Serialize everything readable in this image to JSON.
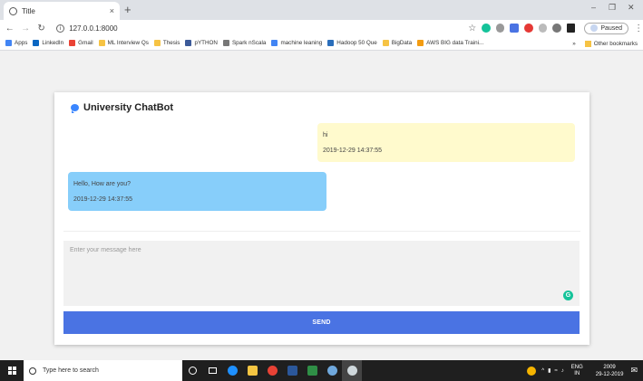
{
  "browser": {
    "tab_title": "Title",
    "tab_close": "×",
    "new_tab": "+",
    "url": "127.0.0.1:8000",
    "profile_status": "Paused",
    "bookmarks": [
      {
        "label": "Apps",
        "color": "#4285f4"
      },
      {
        "label": "LinkedIn",
        "color": "#0a66c2"
      },
      {
        "label": "Gmail",
        "color": "#ea4335"
      },
      {
        "label": "ML Interview Qs",
        "color": "#f6c344"
      },
      {
        "label": "Thesis",
        "color": "#f6c344"
      },
      {
        "label": "pYTHON",
        "color": "#3c5a99"
      },
      {
        "label": "Spark nScala",
        "color": "#777777"
      },
      {
        "label": "machine leaning",
        "color": "#4285f4"
      },
      {
        "label": "Hadoop 50 Que",
        "color": "#2a6ebb"
      },
      {
        "label": "BigData",
        "color": "#f6c344"
      },
      {
        "label": "AWS BIG data Traini...",
        "color": "#f39c12"
      }
    ],
    "bookmarks_more": "»",
    "other_bookmarks": "Other bookmarks"
  },
  "chat": {
    "title": "University ChatBot",
    "messages": [
      {
        "role": "user",
        "text": "hi",
        "time": "2019-12-29 14:37:55"
      },
      {
        "role": "bot",
        "text": "Hello, How are you?",
        "time": "2019-12-29 14:37:55"
      }
    ],
    "input_placeholder": "Enter your message here",
    "send_label": "SEND"
  },
  "taskbar": {
    "search_placeholder": "Type here to search",
    "lang_top": "ENG",
    "lang_bottom": "IN",
    "time": "2009",
    "date": "29-12-2019"
  }
}
